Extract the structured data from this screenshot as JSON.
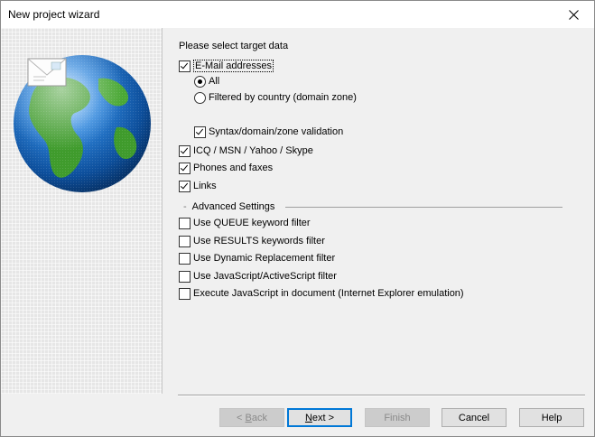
{
  "window": {
    "title": "New project wizard",
    "close_glyph": "×"
  },
  "heading": "Please select target data",
  "options": {
    "email": {
      "label": "E-Mail addresses",
      "checked": true
    },
    "all": {
      "label": "All",
      "checked": true
    },
    "filtered": {
      "label": "Filtered by country (domain zone)",
      "checked": false
    },
    "syntax": {
      "label": "Syntax/domain/zone validation",
      "checked": true
    },
    "icq": {
      "label": "ICQ / MSN / Yahoo / Skype",
      "checked": true
    },
    "phones": {
      "label": "Phones and faxes",
      "checked": true
    },
    "links": {
      "label": "Links",
      "checked": true
    }
  },
  "advanced": {
    "dash": "-",
    "title": "Advanced Settings",
    "queue": {
      "label": "Use QUEUE keyword filter",
      "checked": false
    },
    "results": {
      "label": "Use RESULTS keywords filter",
      "checked": false
    },
    "dynamic": {
      "label": "Use Dynamic Replacement filter",
      "checked": false
    },
    "javascript": {
      "label": "Use JavaScript/ActiveScript filter",
      "checked": false
    },
    "execute": {
      "label": "Execute JavaScript in document (Internet Explorer emulation)",
      "checked": false
    }
  },
  "buttons": {
    "back_prefix": "< ",
    "back_accel": "B",
    "back_rest": "ack",
    "next_accel": "N",
    "next_rest": "ext >",
    "finish": "Finish",
    "cancel": "Cancel",
    "help": "Help"
  },
  "colors": {
    "accent": "#0078d7",
    "globe_ocean": "#1a6fc4",
    "globe_land": "#3a9a2a"
  },
  "icons": [
    "globe-icon",
    "envelope-icon",
    "close-icon"
  ]
}
